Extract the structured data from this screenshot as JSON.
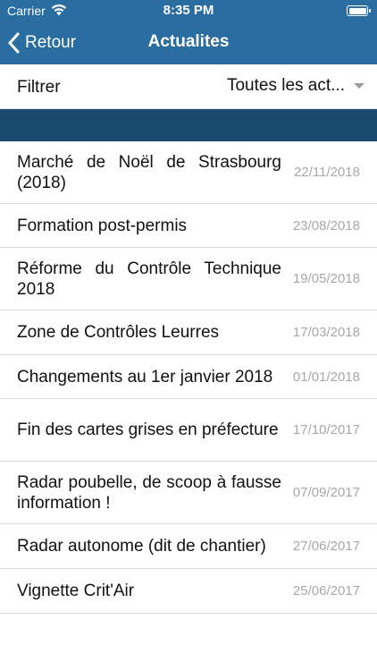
{
  "status": {
    "carrier": "Carrier",
    "time": "8:35 PM",
    "battery_level": 1.0,
    "wifi_icon": "wifi-icon",
    "battery_icon": "battery-icon"
  },
  "nav": {
    "back_label": "Retour",
    "back_icon": "chevron-left-icon",
    "title": "Actualites",
    "bar_color": "#2a6da0"
  },
  "filter": {
    "label": "Filtrer",
    "selected": "Toutes les act...",
    "caret_icon": "caret-down-icon"
  },
  "section": {
    "color": "#1a4b6f"
  },
  "articles": [
    {
      "title": "Marché de Noël de Strasbourg (2018)",
      "date": "22/11/2018"
    },
    {
      "title": "Formation post-permis",
      "date": "23/08/2018"
    },
    {
      "title": "Réforme du Contrôle Technique 2018",
      "date": "19/05/2018"
    },
    {
      "title": "Zone de Contrôles Leurres",
      "date": "17/03/2018"
    },
    {
      "title": "Changements au 1er janvier 2018",
      "date": "01/01/2018"
    },
    {
      "title": "Fin des cartes grises en préfecture",
      "date": "17/10/2017"
    },
    {
      "title": "Radar poubelle, de scoop à fausse information !",
      "date": "07/09/2017"
    },
    {
      "title": "Radar autonome (dit de chantier)",
      "date": "27/06/2017"
    },
    {
      "title": "Vignette Crit'Air",
      "date": "25/06/2017"
    }
  ]
}
